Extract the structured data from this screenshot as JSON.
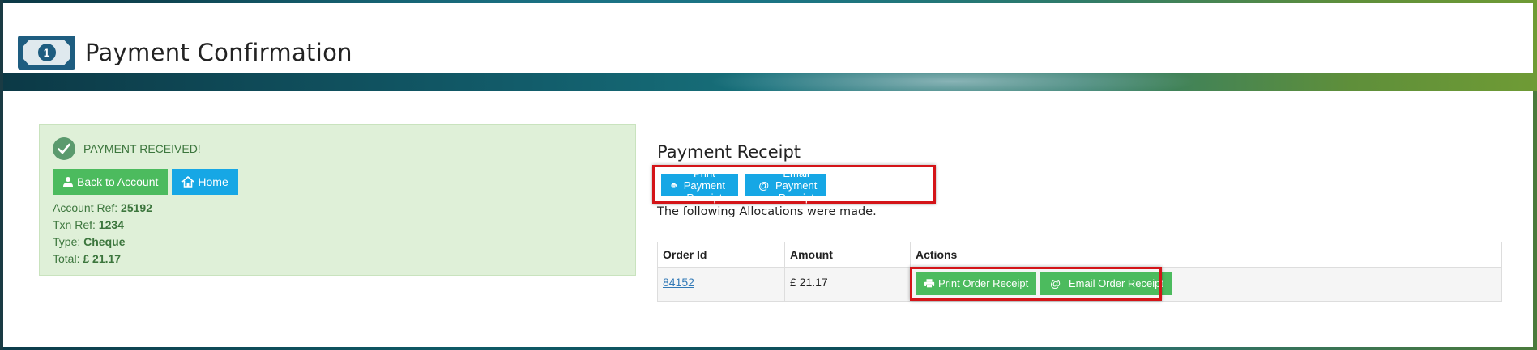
{
  "header": {
    "title": "Payment Confirmation",
    "logo_number": "1"
  },
  "status": {
    "message": "PAYMENT RECEIVED!",
    "back_button": "Back to Account",
    "home_button": "Home",
    "account_ref_label": "Account Ref:",
    "account_ref": "25192",
    "txn_ref_label": "Txn Ref:",
    "txn_ref": "1234",
    "type_label": "Type:",
    "type": "Cheque",
    "total_label": "Total:",
    "total": "£ 21.17"
  },
  "receipt": {
    "title": "Payment Receipt",
    "print_button": "Print Payment Receipt",
    "email_button": "Email Payment Receipt",
    "allocations_text": "The following Allocations were made."
  },
  "table": {
    "headers": [
      "Order Id",
      "Amount",
      "Actions"
    ],
    "rows": [
      {
        "order_id": "84152",
        "amount": "£ 21.17",
        "print_label": "Print Order Receipt",
        "email_label": "Email Order Receipt"
      }
    ]
  },
  "colors": {
    "green": "#4cbb5e",
    "blue": "#16a7e5",
    "highlight": "#d41418",
    "success_bg": "#dff0d8"
  }
}
